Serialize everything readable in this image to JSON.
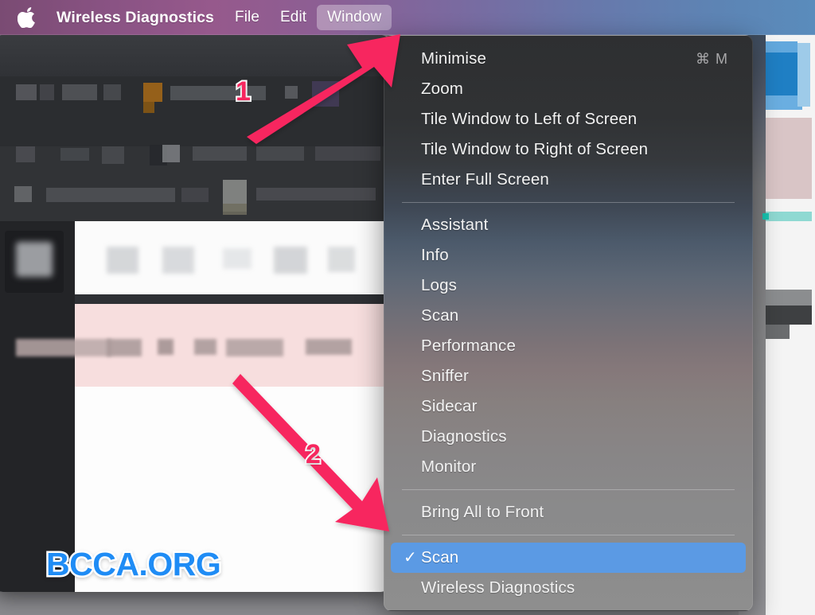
{
  "menubar": {
    "apple_icon": "apple-logo-icon",
    "app_name": "Wireless Diagnostics",
    "items": [
      {
        "label": "File",
        "active": false
      },
      {
        "label": "Edit",
        "active": false
      },
      {
        "label": "Window",
        "active": true
      }
    ]
  },
  "window_menu": {
    "groups": [
      {
        "items": [
          {
            "label": "Minimise",
            "shortcut": "⌘ M",
            "checked": false,
            "selected": false
          },
          {
            "label": "Zoom",
            "shortcut": "",
            "checked": false,
            "selected": false
          },
          {
            "label": "Tile Window to Left of Screen",
            "shortcut": "",
            "checked": false,
            "selected": false
          },
          {
            "label": "Tile Window to Right of Screen",
            "shortcut": "",
            "checked": false,
            "selected": false
          },
          {
            "label": "Enter Full Screen",
            "shortcut": "",
            "checked": false,
            "selected": false
          }
        ]
      },
      {
        "items": [
          {
            "label": "Assistant",
            "shortcut": "",
            "checked": false,
            "selected": false
          },
          {
            "label": "Info",
            "shortcut": "",
            "checked": false,
            "selected": false
          },
          {
            "label": "Logs",
            "shortcut": "",
            "checked": false,
            "selected": false
          },
          {
            "label": "Scan",
            "shortcut": "",
            "checked": false,
            "selected": false
          },
          {
            "label": "Performance",
            "shortcut": "",
            "checked": false,
            "selected": false
          },
          {
            "label": "Sniffer",
            "shortcut": "",
            "checked": false,
            "selected": false
          },
          {
            "label": "Sidecar",
            "shortcut": "",
            "checked": false,
            "selected": false
          },
          {
            "label": "Diagnostics",
            "shortcut": "",
            "checked": false,
            "selected": false
          },
          {
            "label": "Monitor",
            "shortcut": "",
            "checked": false,
            "selected": false
          }
        ]
      },
      {
        "items": [
          {
            "label": "Bring All to Front",
            "shortcut": "",
            "checked": false,
            "selected": false
          }
        ]
      },
      {
        "items": [
          {
            "label": "Scan",
            "shortcut": "",
            "checked": true,
            "selected": true
          },
          {
            "label": "Wireless Diagnostics",
            "shortcut": "",
            "checked": false,
            "selected": false
          }
        ]
      }
    ]
  },
  "annotations": [
    {
      "number": "1",
      "target": "window-menubar-item"
    },
    {
      "number": "2",
      "target": "scan-menu-item"
    }
  ],
  "watermark": {
    "text": "BCCA.ORG"
  },
  "colors": {
    "accent_selection": "#5b9ae4",
    "annotation_pink": "#f7275f",
    "watermark_blue": "#1f8cf5",
    "menubar_left": "#96598c",
    "menubar_right": "#5a8cbc"
  }
}
